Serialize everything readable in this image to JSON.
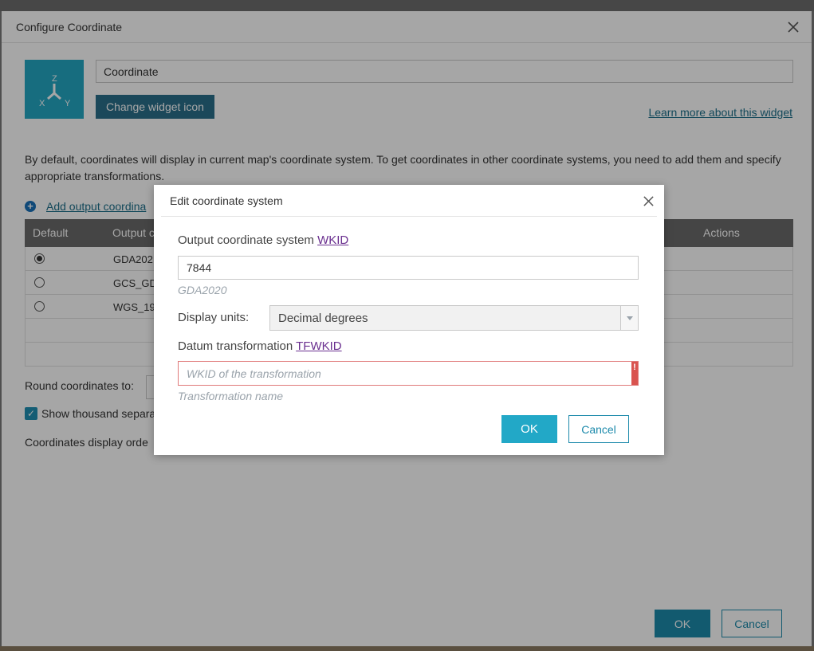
{
  "outer_dialog": {
    "title": "Configure Coordinate",
    "name_value": "Coordinate",
    "change_icon_label": "Change widget icon",
    "learn_more_label": "Learn more about this widget",
    "description": "By default, coordinates will display in current map's coordinate system. To get coordinates in other coordinate systems, you need to add them and specify appropriate transformations.",
    "add_output_label": "Add output coordina",
    "table": {
      "headers": {
        "default": "Default",
        "output": "Output c",
        "actions": "Actions"
      },
      "rows": [
        {
          "name": "GDA202",
          "default": true
        },
        {
          "name": "GCS_GD",
          "default": false
        },
        {
          "name": "WGS_19",
          "default": false
        }
      ]
    },
    "round_label": "Round coordinates to:",
    "show_thousand_label": "Show thousand separa",
    "show_thousand_checked": true,
    "order_label": "Coordinates display orde",
    "ok_label": "OK",
    "cancel_label": "Cancel"
  },
  "inner_dialog": {
    "title": "Edit coordinate system",
    "output_label": "Output coordinate system",
    "output_link": "WKID",
    "wkid_value": "7844",
    "wkid_hint": "GDA2020",
    "units_label": "Display units:",
    "units_value": "Decimal degrees",
    "datum_label": "Datum transformation",
    "datum_link": "TFWKID",
    "tf_placeholder": "WKID of the transformation",
    "tf_hint": "Transformation name",
    "error_mark": "!",
    "ok_label": "OK",
    "cancel_label": "Cancel"
  },
  "colors": {
    "accent": "#22a8c7",
    "error": "#d9534f",
    "link_visited": "#6a2f8f"
  }
}
